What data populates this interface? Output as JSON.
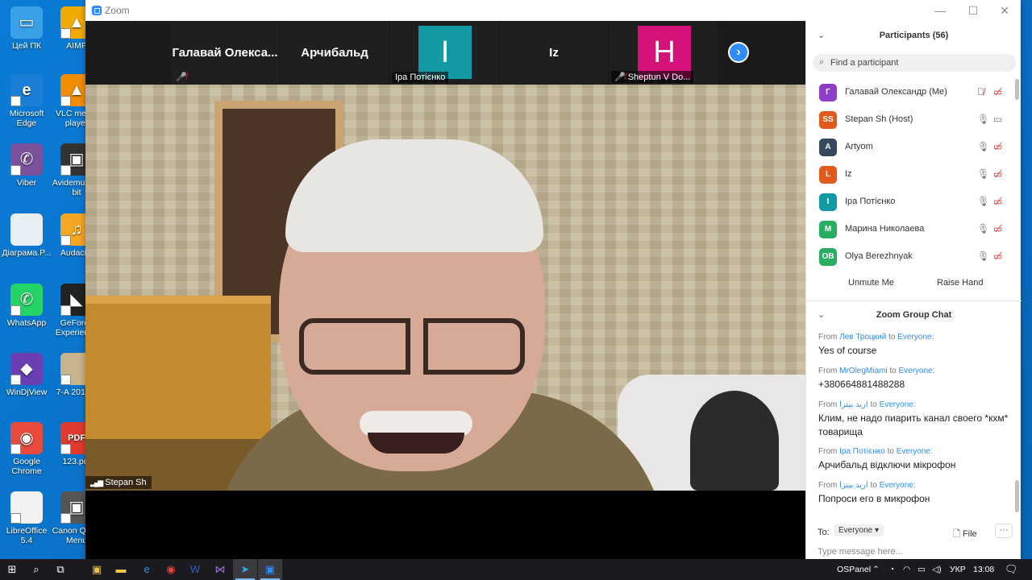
{
  "desktop": {
    "icons": [
      {
        "label": "Цей ПК",
        "color": "#3aa0e8",
        "glyph": "▭"
      },
      {
        "label": "Microsoft Edge",
        "color": "#1b7fd8",
        "glyph": "e"
      },
      {
        "label": "Viber",
        "color": "#7b519d",
        "glyph": "✆"
      },
      {
        "label": "Діаграма.P...",
        "color": "#e8eef5",
        "glyph": ""
      },
      {
        "label": "WhatsApp",
        "color": "#25d366",
        "glyph": "✆"
      },
      {
        "label": "WinDjView",
        "color": "#6a3fb4",
        "glyph": "◆"
      },
      {
        "label": "Google Chrome",
        "color": "#e84a3b",
        "glyph": "◉"
      },
      {
        "label": "LibreOffice 5.4",
        "color": "#f1f1f1",
        "glyph": ""
      },
      {
        "label": "AIMP",
        "color": "#f2a900",
        "glyph": "▲"
      },
      {
        "label": "VLC media player",
        "color": "#f28c00",
        "glyph": "▲"
      },
      {
        "label": "Avidemux 64 bit",
        "color": "#333333",
        "glyph": "▣"
      },
      {
        "label": "Audacity",
        "color": "#f5a623",
        "glyph": "♫"
      },
      {
        "label": "GeForce Experience",
        "color": "#222222",
        "glyph": "◣"
      },
      {
        "label": "7-A 2013 2",
        "color": "#c8b48a",
        "glyph": ""
      },
      {
        "label": "123.pdf",
        "color": "#e03a2f",
        "glyph": "PDF"
      },
      {
        "label": "Canon Quick Menu",
        "color": "#555555",
        "glyph": "▣"
      }
    ]
  },
  "window": {
    "title": "Zoom",
    "controls": {
      "minimize": "—",
      "maximize": "☐",
      "close": "✕"
    }
  },
  "thumbnails": [
    {
      "name": "Галавай  Олекса...",
      "muted": true
    },
    {
      "name": "Арчибальд"
    },
    {
      "initial": "I",
      "color": "#119aa4",
      "label": "Іра Потієнко"
    },
    {
      "name": "Iz"
    },
    {
      "initial": "H",
      "color": "#d4127a",
      "label": "Sheptun V Do...",
      "muted": true
    }
  ],
  "active_speaker": {
    "name": "Stepan Sh"
  },
  "participants": {
    "title": "Participants (56)",
    "search_placeholder": "Find a participant",
    "list": [
      {
        "avatar": "Г",
        "color": "#8e3fc8",
        "name": "Галавай Олександр (Me)",
        "mic": "muted",
        "cam": "off"
      },
      {
        "avatar": "SS",
        "color": "#e05a1c",
        "name": "Stepan Sh (Host)",
        "mic": "on",
        "cam": "on"
      },
      {
        "avatar": "A",
        "color": "#34495e",
        "name": "Artyom",
        "mic": "on",
        "cam": "off"
      },
      {
        "avatar": "L",
        "color": "#e05a1c",
        "name": "Iz",
        "mic": "on",
        "cam": "off"
      },
      {
        "avatar": "I",
        "color": "#119aa4",
        "name": "Іра Потієнко",
        "mic": "on",
        "cam": "off"
      },
      {
        "avatar": "M",
        "color": "#27ae60",
        "name": "Марина Николаева",
        "mic": "on",
        "cam": "off"
      },
      {
        "avatar": "OB",
        "color": "#27ae60",
        "name": "Olya Berezhnyak",
        "mic": "on",
        "cam": "off"
      }
    ],
    "unmute_label": "Unmute Me",
    "raise_hand_label": "Raise Hand"
  },
  "chat": {
    "title": "Zoom Group Chat",
    "messages": [
      {
        "from_prefix": "From",
        "from": "Лев Троцкий",
        "to_word": "to",
        "to": "Everyone:",
        "text": "Yes of course"
      },
      {
        "from_prefix": "From",
        "from": "MrOlegMiami",
        "to_word": "to",
        "to": "Everyone:",
        "text": "+380664881488288"
      },
      {
        "from_prefix": "From",
        "from": "ارید بیتزا",
        "to_word": "to",
        "to": "Everyone:",
        "text": "Клим, не надо пиарить канал своего *кхм* товарища"
      },
      {
        "from_prefix": "From",
        "from": "Іра Потієнко",
        "to_word": "to",
        "to": "Everyone:",
        "text": "Арчибальд відключи мікрофон"
      },
      {
        "from_prefix": "From",
        "from": "ارید بیتزا",
        "to_word": "to",
        "to": "Everyone:",
        "text": "Попроси его в микрофон"
      }
    ],
    "to_label": "To:",
    "to_value": "Everyone",
    "file_label": "File",
    "more_label": "···",
    "input_placeholder": "Type message here..."
  },
  "taskbar": {
    "tray_app": "OSPanel",
    "language": "УКР",
    "time": "13:08"
  }
}
